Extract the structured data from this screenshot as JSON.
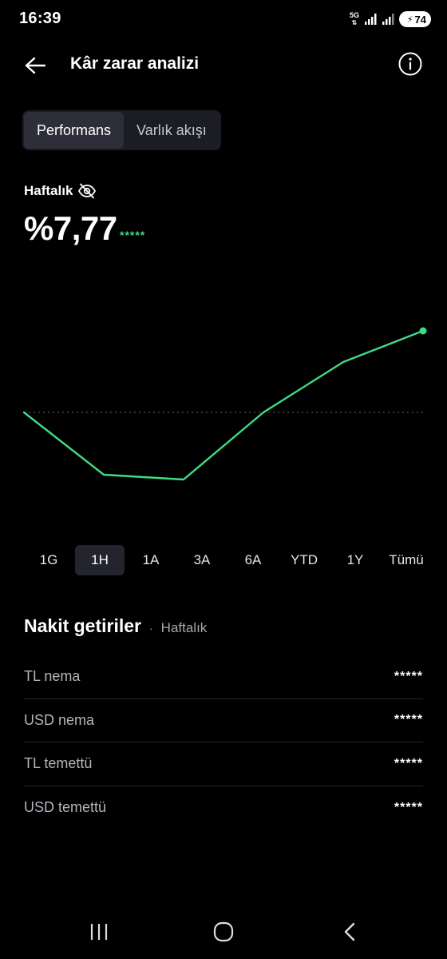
{
  "status": {
    "time": "16:39",
    "network": "5G",
    "battery": "74"
  },
  "header": {
    "title": "Kâr zarar analizi"
  },
  "tabs": [
    {
      "label": "Performans",
      "active": true
    },
    {
      "label": "Varlık akışı",
      "active": false
    }
  ],
  "summary": {
    "period": "Haftalık",
    "value": "%7,77",
    "masked": "*****"
  },
  "chart_data": {
    "type": "line",
    "title": "",
    "xlabel": "",
    "ylabel": "",
    "x": [
      1,
      2,
      3,
      4,
      5,
      6
    ],
    "values": [
      0.0,
      -1.3,
      -1.4,
      0.0,
      1.05,
      1.7
    ],
    "baseline": 0,
    "ylim": [
      -2.4,
      3.1
    ],
    "grid": false,
    "line_color": "#3ddc84",
    "baseline_color": "#55555f"
  },
  "ranges": [
    {
      "label": "1G",
      "active": false
    },
    {
      "label": "1H",
      "active": true
    },
    {
      "label": "1A",
      "active": false
    },
    {
      "label": "3A",
      "active": false
    },
    {
      "label": "6A",
      "active": false
    },
    {
      "label": "YTD",
      "active": false
    },
    {
      "label": "1Y",
      "active": false
    },
    {
      "label": "Tümü",
      "active": false
    }
  ],
  "cash": {
    "title": "Nakit getiriler",
    "period": "Haftalık",
    "rows": [
      {
        "label": "TL nema",
        "value": "*****"
      },
      {
        "label": "USD nema",
        "value": "*****"
      },
      {
        "label": "TL temettü",
        "value": "*****"
      },
      {
        "label": "USD temettü",
        "value": "*****"
      }
    ]
  },
  "colors": {
    "accent": "#3ddc84",
    "background": "#000000"
  }
}
